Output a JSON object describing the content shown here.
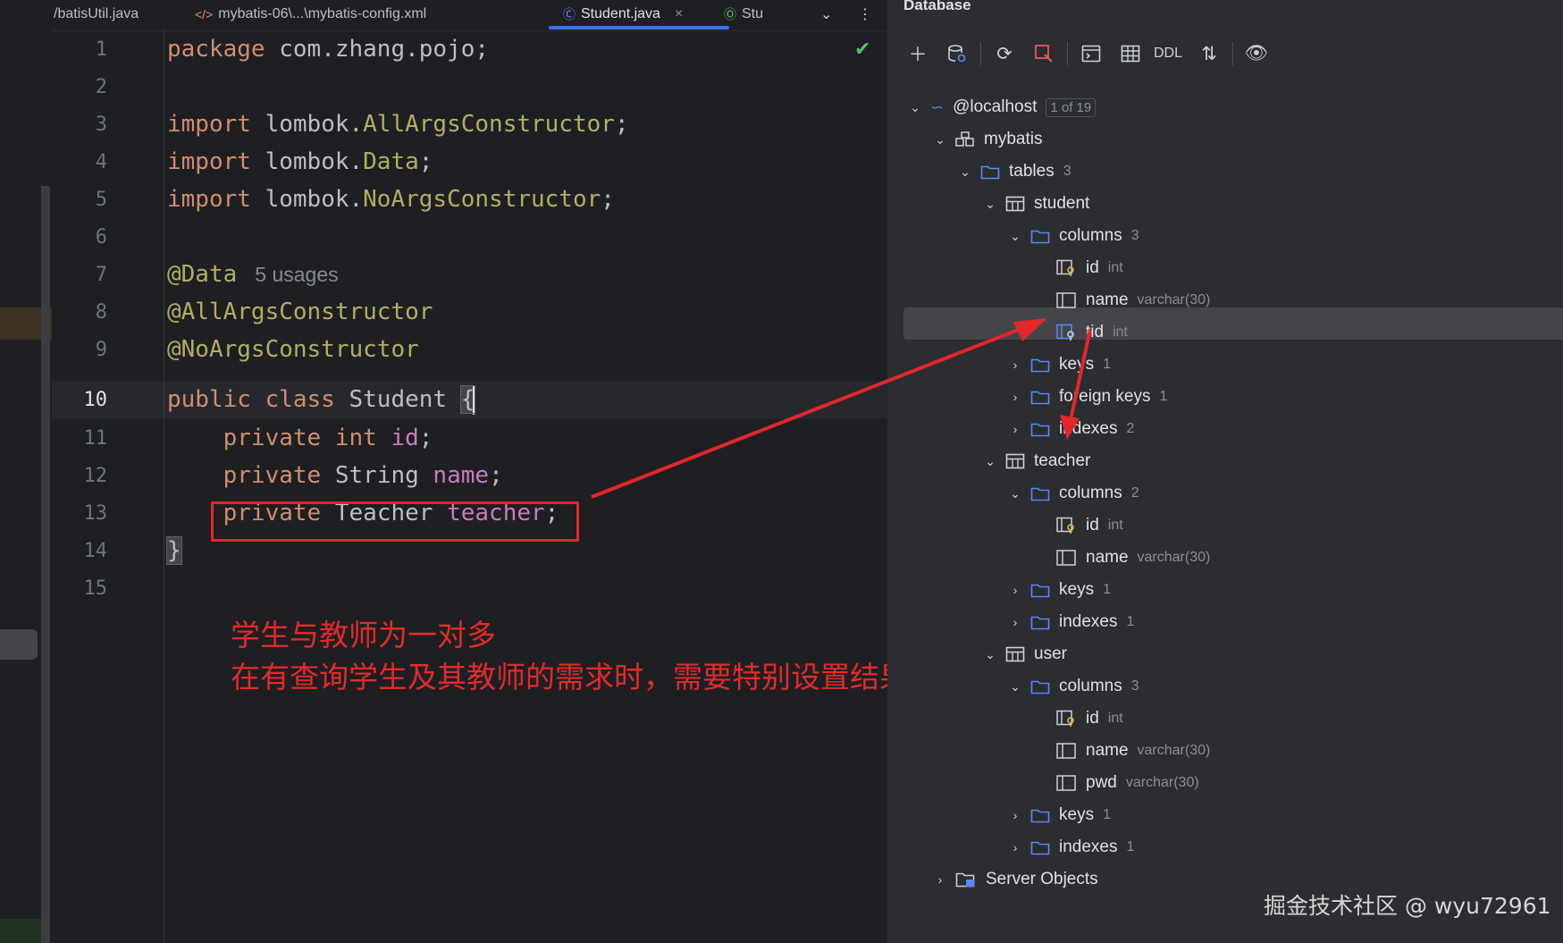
{
  "tabs": [
    {
      "label": "/batisUtil.java",
      "icon": "java-file-icon"
    },
    {
      "label": "mybatis-06\\...\\mybatis-config.xml",
      "icon": "xml-file-icon"
    },
    {
      "label": "Student.java",
      "icon": "class-icon",
      "active": true
    },
    {
      "label": "Stu",
      "icon": "interface-icon"
    }
  ],
  "editor": {
    "lines": [
      "1",
      "2",
      "3",
      "4",
      "5",
      "6",
      "7",
      "8",
      "9",
      "10",
      "11",
      "12",
      "13",
      "14",
      "15"
    ],
    "current_line": "10",
    "code": {
      "l1_kw": "package",
      "l1_rest": " com.zhang.pojo;",
      "import_kw": "import",
      "l3_pkg": " lombok.",
      "l3_cls": "AllArgsConstructor",
      "semi": ";",
      "l4_cls": "Data",
      "l5_cls": "NoArgsConstructor",
      "l7_ann": "@Data",
      "l7_usages": "5 usages",
      "l8_ann": "@AllArgsConstructor",
      "l9_ann": "@NoArgsConstructor",
      "l10_kw": "public class",
      "l10_name": " Student ",
      "l10_brace": "{",
      "private_kw": "private",
      "l11_type": " int",
      "l11_field": " id",
      "l12_type": " String",
      "l12_field": " name",
      "l13_type": " Teacher",
      "l13_field": " teacher",
      "l14_brace": "}"
    }
  },
  "annotation_note": {
    "line1": "学生与教师为一对多",
    "line2": "在有查询学生及其教师的需求时，需要特别设置结果集"
  },
  "database": {
    "title": "Database",
    "toolbar": {
      "ddl_label": "DDL"
    },
    "tree": {
      "host": "@localhost",
      "host_badge": "1 of 19",
      "schema": "mybatis",
      "tables_label": "tables",
      "tables_count": "3",
      "student": {
        "name": "student",
        "columns_label": "columns",
        "columns_count": "3",
        "cols": [
          {
            "name": "id",
            "type": "int"
          },
          {
            "name": "name",
            "type": "varchar(30)"
          },
          {
            "name": "tid",
            "type": "int"
          }
        ],
        "keys_label": "keys",
        "keys_count": "1",
        "fk_label": "foreign keys",
        "fk_count": "1",
        "indexes_label": "indexes",
        "indexes_count": "2"
      },
      "teacher": {
        "name": "teacher",
        "columns_label": "columns",
        "columns_count": "2",
        "cols": [
          {
            "name": "id",
            "type": "int"
          },
          {
            "name": "name",
            "type": "varchar(30)"
          }
        ],
        "keys_label": "keys",
        "keys_count": "1",
        "indexes_label": "indexes",
        "indexes_count": "1"
      },
      "user": {
        "name": "user",
        "columns_label": "columns",
        "columns_count": "3",
        "cols": [
          {
            "name": "id",
            "type": "int"
          },
          {
            "name": "name",
            "type": "varchar(30)"
          },
          {
            "name": "pwd",
            "type": "varchar(30)"
          }
        ],
        "keys_label": "keys",
        "keys_count": "1",
        "indexes_label": "indexes",
        "indexes_count": "1"
      },
      "server_objects": "Server Objects"
    }
  },
  "watermark": "掘金技术社区 @ wyu72961",
  "colors": {
    "accent": "#3574f0",
    "annotation_red": "#e3262a",
    "keyword": "#cf8e6d",
    "field": "#c77dbb",
    "annotation": "#b3ae60"
  }
}
